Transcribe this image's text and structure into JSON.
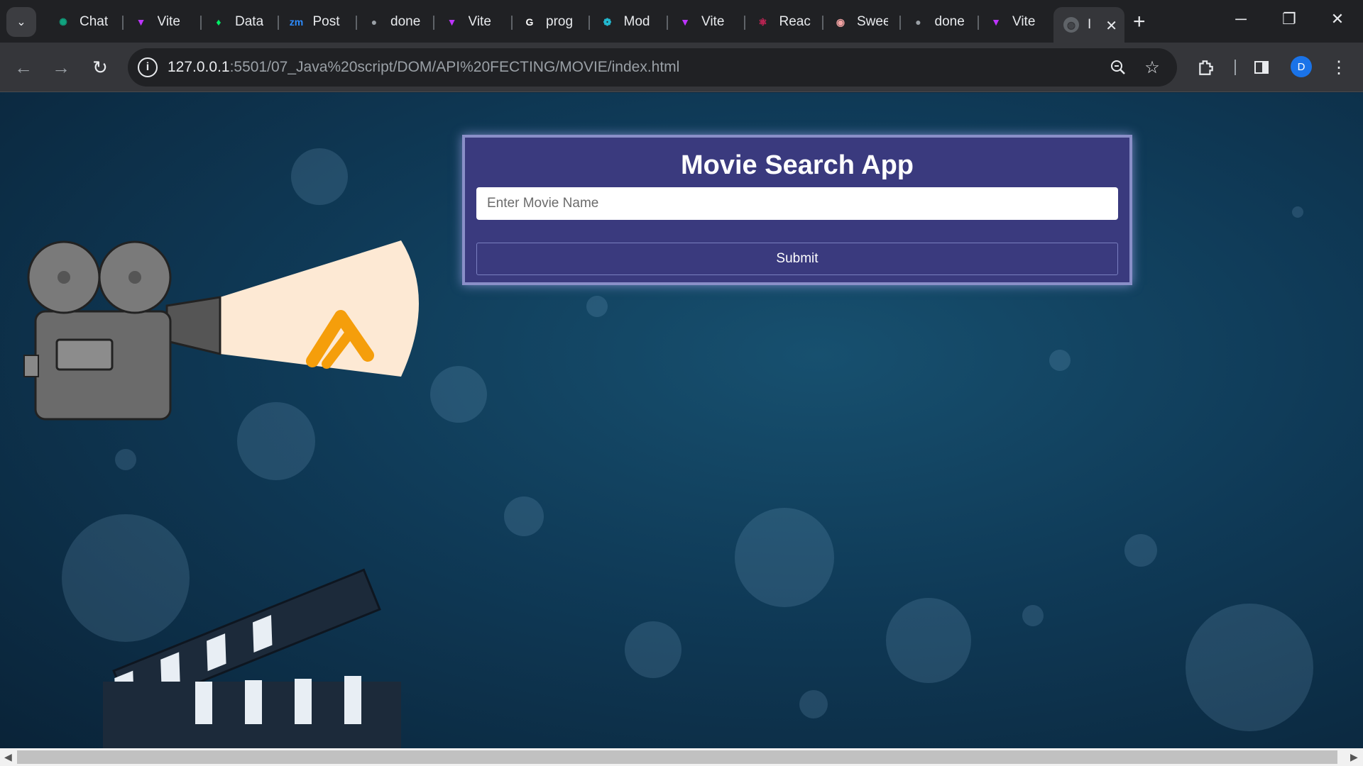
{
  "browser": {
    "tabs": [
      {
        "label": "Chat",
        "icon": "chatgpt-icon",
        "color": "#10a37f"
      },
      {
        "label": "Vite",
        "icon": "vite-icon",
        "color": "#bd34fe"
      },
      {
        "label": "Data",
        "icon": "mongodb-icon",
        "color": "#00ed64"
      },
      {
        "label": "Post",
        "icon": "zoom-icon",
        "color": "#2d8cff"
      },
      {
        "label": "done",
        "icon": "github-icon",
        "color": "#9aa0a6"
      },
      {
        "label": "Vite",
        "icon": "vite-icon",
        "color": "#bd34fe"
      },
      {
        "label": "prog",
        "icon": "google-icon",
        "color": "#ffffff"
      },
      {
        "label": "Mod",
        "icon": "mod-icon",
        "color": "#22b8cf"
      },
      {
        "label": "Vite",
        "icon": "vite-icon",
        "color": "#bd34fe"
      },
      {
        "label": "Reac",
        "icon": "react-icon",
        "color": "#e0245e"
      },
      {
        "label": "Swee",
        "icon": "sweet-icon",
        "color": "#f2a3a3"
      },
      {
        "label": "done",
        "icon": "github-icon",
        "color": "#9aa0a6"
      },
      {
        "label": "Vite",
        "icon": "vite-icon",
        "color": "#bd34fe"
      }
    ],
    "active_tab": {
      "label": "I",
      "icon": "globe-icon"
    },
    "url_host": "127.0.0.1",
    "url_rest": ":5501/07_Java%20script/DOM/API%20FECTING/MOVIE/index.html",
    "profile_initial": "D"
  },
  "page": {
    "title": "Movie Search App",
    "input_placeholder": "Enter Movie Name",
    "input_value": "",
    "submit_label": "Submit"
  },
  "colors": {
    "card_bg": "#3a3a7e",
    "logo_orange": "#f59e0b",
    "page_bg": "#0f3a57"
  }
}
